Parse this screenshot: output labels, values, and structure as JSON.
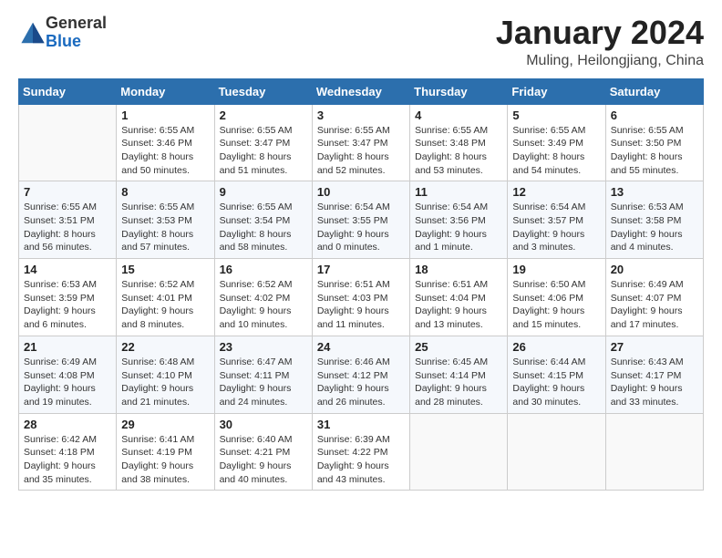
{
  "logo": {
    "general": "General",
    "blue": "Blue"
  },
  "header": {
    "month_title": "January 2024",
    "location": "Muling, Heilongjiang, China"
  },
  "days_of_week": [
    "Sunday",
    "Monday",
    "Tuesday",
    "Wednesday",
    "Thursday",
    "Friday",
    "Saturday"
  ],
  "weeks": [
    [
      {
        "day": "",
        "info": ""
      },
      {
        "day": "1",
        "info": "Sunrise: 6:55 AM\nSunset: 3:46 PM\nDaylight: 8 hours\nand 50 minutes."
      },
      {
        "day": "2",
        "info": "Sunrise: 6:55 AM\nSunset: 3:47 PM\nDaylight: 8 hours\nand 51 minutes."
      },
      {
        "day": "3",
        "info": "Sunrise: 6:55 AM\nSunset: 3:47 PM\nDaylight: 8 hours\nand 52 minutes."
      },
      {
        "day": "4",
        "info": "Sunrise: 6:55 AM\nSunset: 3:48 PM\nDaylight: 8 hours\nand 53 minutes."
      },
      {
        "day": "5",
        "info": "Sunrise: 6:55 AM\nSunset: 3:49 PM\nDaylight: 8 hours\nand 54 minutes."
      },
      {
        "day": "6",
        "info": "Sunrise: 6:55 AM\nSunset: 3:50 PM\nDaylight: 8 hours\nand 55 minutes."
      }
    ],
    [
      {
        "day": "7",
        "info": "Sunrise: 6:55 AM\nSunset: 3:51 PM\nDaylight: 8 hours\nand 56 minutes."
      },
      {
        "day": "8",
        "info": "Sunrise: 6:55 AM\nSunset: 3:53 PM\nDaylight: 8 hours\nand 57 minutes."
      },
      {
        "day": "9",
        "info": "Sunrise: 6:55 AM\nSunset: 3:54 PM\nDaylight: 8 hours\nand 58 minutes."
      },
      {
        "day": "10",
        "info": "Sunrise: 6:54 AM\nSunset: 3:55 PM\nDaylight: 9 hours\nand 0 minutes."
      },
      {
        "day": "11",
        "info": "Sunrise: 6:54 AM\nSunset: 3:56 PM\nDaylight: 9 hours\nand 1 minute."
      },
      {
        "day": "12",
        "info": "Sunrise: 6:54 AM\nSunset: 3:57 PM\nDaylight: 9 hours\nand 3 minutes."
      },
      {
        "day": "13",
        "info": "Sunrise: 6:53 AM\nSunset: 3:58 PM\nDaylight: 9 hours\nand 4 minutes."
      }
    ],
    [
      {
        "day": "14",
        "info": "Sunrise: 6:53 AM\nSunset: 3:59 PM\nDaylight: 9 hours\nand 6 minutes."
      },
      {
        "day": "15",
        "info": "Sunrise: 6:52 AM\nSunset: 4:01 PM\nDaylight: 9 hours\nand 8 minutes."
      },
      {
        "day": "16",
        "info": "Sunrise: 6:52 AM\nSunset: 4:02 PM\nDaylight: 9 hours\nand 10 minutes."
      },
      {
        "day": "17",
        "info": "Sunrise: 6:51 AM\nSunset: 4:03 PM\nDaylight: 9 hours\nand 11 minutes."
      },
      {
        "day": "18",
        "info": "Sunrise: 6:51 AM\nSunset: 4:04 PM\nDaylight: 9 hours\nand 13 minutes."
      },
      {
        "day": "19",
        "info": "Sunrise: 6:50 AM\nSunset: 4:06 PM\nDaylight: 9 hours\nand 15 minutes."
      },
      {
        "day": "20",
        "info": "Sunrise: 6:49 AM\nSunset: 4:07 PM\nDaylight: 9 hours\nand 17 minutes."
      }
    ],
    [
      {
        "day": "21",
        "info": "Sunrise: 6:49 AM\nSunset: 4:08 PM\nDaylight: 9 hours\nand 19 minutes."
      },
      {
        "day": "22",
        "info": "Sunrise: 6:48 AM\nSunset: 4:10 PM\nDaylight: 9 hours\nand 21 minutes."
      },
      {
        "day": "23",
        "info": "Sunrise: 6:47 AM\nSunset: 4:11 PM\nDaylight: 9 hours\nand 24 minutes."
      },
      {
        "day": "24",
        "info": "Sunrise: 6:46 AM\nSunset: 4:12 PM\nDaylight: 9 hours\nand 26 minutes."
      },
      {
        "day": "25",
        "info": "Sunrise: 6:45 AM\nSunset: 4:14 PM\nDaylight: 9 hours\nand 28 minutes."
      },
      {
        "day": "26",
        "info": "Sunrise: 6:44 AM\nSunset: 4:15 PM\nDaylight: 9 hours\nand 30 minutes."
      },
      {
        "day": "27",
        "info": "Sunrise: 6:43 AM\nSunset: 4:17 PM\nDaylight: 9 hours\nand 33 minutes."
      }
    ],
    [
      {
        "day": "28",
        "info": "Sunrise: 6:42 AM\nSunset: 4:18 PM\nDaylight: 9 hours\nand 35 minutes."
      },
      {
        "day": "29",
        "info": "Sunrise: 6:41 AM\nSunset: 4:19 PM\nDaylight: 9 hours\nand 38 minutes."
      },
      {
        "day": "30",
        "info": "Sunrise: 6:40 AM\nSunset: 4:21 PM\nDaylight: 9 hours\nand 40 minutes."
      },
      {
        "day": "31",
        "info": "Sunrise: 6:39 AM\nSunset: 4:22 PM\nDaylight: 9 hours\nand 43 minutes."
      },
      {
        "day": "",
        "info": ""
      },
      {
        "day": "",
        "info": ""
      },
      {
        "day": "",
        "info": ""
      }
    ]
  ]
}
